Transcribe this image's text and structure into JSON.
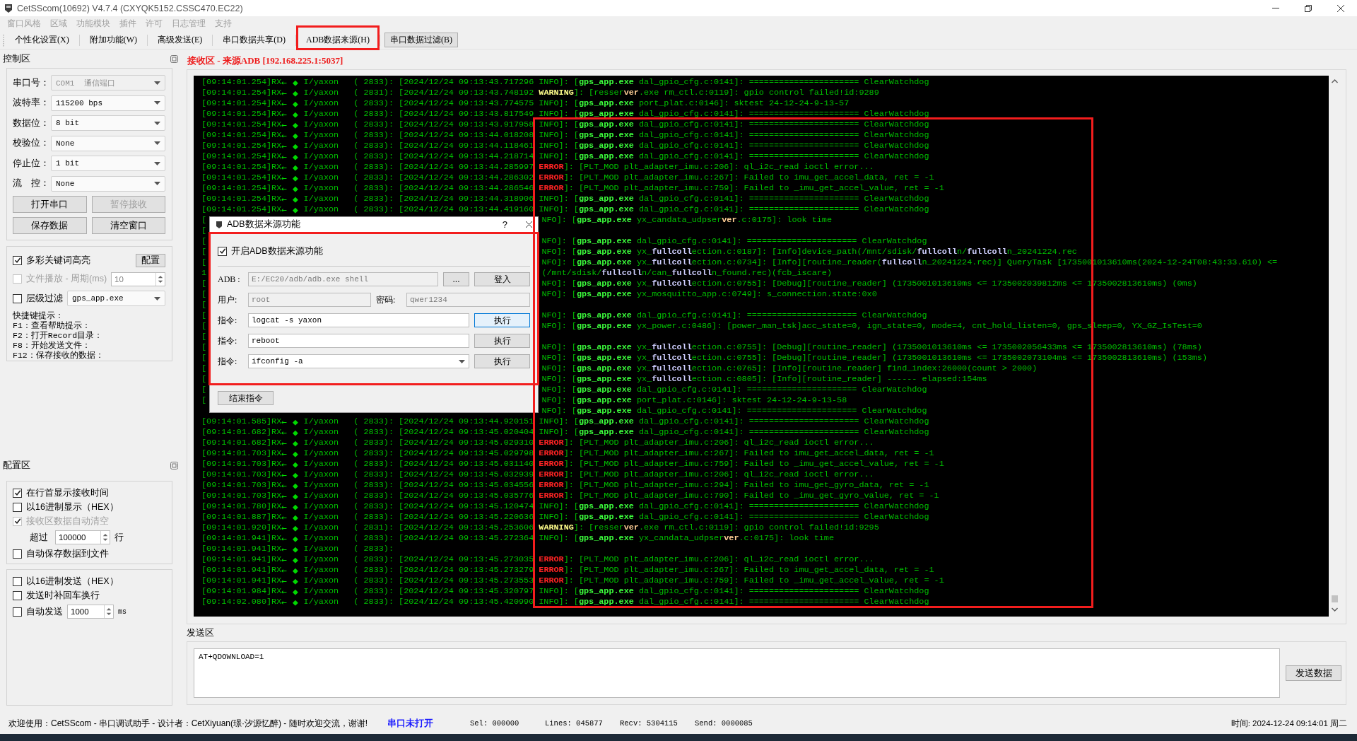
{
  "window": {
    "title": "CetSScom(10692) V4.7.4 (CXYQK5152.CSSC470.EC22)"
  },
  "menu": [
    {
      "label": "窗口风格",
      "disabled": true
    },
    {
      "label": "区域",
      "disabled": true
    },
    {
      "label": "功能模块",
      "disabled": true
    },
    {
      "label": "插件",
      "disabled": true
    },
    {
      "label": "许可",
      "disabled": true
    },
    {
      "label": "日志管理",
      "disabled": true
    },
    {
      "label": "支持",
      "disabled": true
    }
  ],
  "toolbar": [
    {
      "label": "个性化设置(X)",
      "selected": false,
      "annotated": false
    },
    {
      "label": "附加功能(W)",
      "selected": false,
      "annotated": false
    },
    {
      "label": "高级发送(E)",
      "selected": false,
      "annotated": false
    },
    {
      "label": "串口数据共享(D)",
      "selected": false,
      "annotated": false
    },
    {
      "label": "ADB数据来源(H)",
      "selected": false,
      "annotated": true
    },
    {
      "label": "串口数据过滤(B)",
      "selected": true,
      "annotated": false
    }
  ],
  "control_panel": {
    "title": "控制区",
    "port_settings": [
      {
        "label": "串口号：",
        "value": "COM1  通信端口",
        "disabled": true
      },
      {
        "label": "波特率：",
        "value": "115200 bps",
        "disabled": false
      },
      {
        "label": "数据位：",
        "value": "8 bit",
        "disabled": false
      },
      {
        "label": "校验位：",
        "value": "None",
        "disabled": false
      },
      {
        "label": "停止位：",
        "value": "1 bit",
        "disabled": false
      },
      {
        "label": "流　控：",
        "value": "None",
        "disabled": false
      }
    ],
    "buttons": [
      {
        "label": "打开串口",
        "disabled": false
      },
      {
        "label": "暂停接收",
        "disabled": true
      },
      {
        "label": "保存数据",
        "disabled": false
      },
      {
        "label": "清空窗口",
        "disabled": false
      }
    ],
    "options": [
      {
        "kind": "check_button",
        "label": "多彩关键词高亮",
        "checked": true,
        "disabled": false,
        "button": "配置"
      },
      {
        "kind": "check_spin",
        "label": "文件播放 - 周期(ms)",
        "checked": false,
        "disabled": true,
        "value": "10"
      },
      {
        "kind": "check_combo",
        "label": "层级过滤",
        "checked": false,
        "disabled": false,
        "value": "gps_app.exe"
      }
    ],
    "hints": [
      "快捷键提示：",
      "F1：查看帮助提示：",
      "F2：打开Record目录：",
      "F8：开始发送文件：",
      "F12：保存接收的数据："
    ]
  },
  "config_panel": {
    "title": "配置区",
    "receive_options": [
      {
        "kind": "check",
        "label": "在行首显示接收时间",
        "checked": true,
        "disabled": false
      },
      {
        "kind": "check",
        "label": "以16进制显示（HEX）",
        "checked": false,
        "disabled": false
      },
      {
        "kind": "check",
        "label": "接收区数据自动清空",
        "checked": true,
        "disabled": true
      },
      {
        "kind": "spin",
        "label": "超过",
        "value": "100000",
        "unit": "行"
      },
      {
        "kind": "check",
        "label": "自动保存数据到文件",
        "checked": false,
        "disabled": false
      }
    ],
    "send_options": [
      {
        "kind": "check",
        "label": "以16进制发送（HEX）",
        "checked": false,
        "disabled": false
      },
      {
        "kind": "check",
        "label": "发送时补回车换行",
        "checked": false,
        "disabled": false
      },
      {
        "kind": "check_spin",
        "label": "自动发送",
        "checked": false,
        "disabled": false,
        "value": "1000",
        "unit": "ms"
      }
    ]
  },
  "receive": {
    "title": "接收区 - 来源ADB [192.168.225.1:5037]",
    "annotated": true,
    "lines": [
      {
        "kind": "full",
        "segments": [
          {
            "text": "[09:14:01.254]RX"
          },
          {
            "text": "←",
            "kind": "wide"
          },
          {
            "text": "◆",
            "kind": "wide"
          },
          {
            "text": "I/yaxon   ( 2833): [2024/12/24 09:13:43.717296 INFO]: ["
          },
          {
            "text": "gps_app.exe",
            "kind": "app"
          },
          {
            "text": " dal_gpio_cfg.c:0141]: ====================== ClearWatchdog"
          }
        ]
      },
      {
        "kind": "full",
        "segments": [
          {
            "text": "[09:14:01.254]RX"
          },
          {
            "text": "←",
            "kind": "wide"
          },
          {
            "text": "◆",
            "kind": "wide"
          },
          {
            "text": "I/yaxon   ( 2831): [2024/12/24 09:13:43.748192 "
          },
          {
            "text": "WARNING",
            "kind": "warning"
          },
          {
            "text": "]: [resser"
          },
          {
            "text": "ver",
            "kind": "ver"
          },
          {
            "text": ".exe rm_ctl.c:0119]: gpio control failed!id:9289"
          }
        ]
      },
      {
        "kind": "full",
        "segments": [
          {
            "text": "[09:14:01.254]RX"
          },
          {
            "text": "←",
            "kind": "wide"
          },
          {
            "text": "◆",
            "kind": "wide"
          },
          {
            "text": "I/yaxon   ( 2833): [2024/12/24 09:13:43.774575 INFO]: ["
          },
          {
            "text": "gps_app.exe",
            "kind": "app"
          },
          {
            "text": " port_plat.c:0146]: sktest 24-12-24-9-13-57"
          }
        ]
      },
      {
        "kind": "full",
        "segments": [
          {
            "text": "[09:14:01.254]RX"
          },
          {
            "text": "←",
            "kind": "wide"
          },
          {
            "text": "◆",
            "kind": "wide"
          },
          {
            "text": "I/yaxon   ( 2833): [2024/12/24 09:13:43.817549 INFO]: ["
          },
          {
            "text": "gps_app.exe",
            "kind": "app"
          },
          {
            "text": " dal_gpio_cfg.c:0141]: ====================== ClearWatchdog"
          }
        ]
      },
      {
        "kind": "full",
        "segments": [
          {
            "text": "[09:14:01.254]RX"
          },
          {
            "text": "←",
            "kind": "wide"
          },
          {
            "text": "◆",
            "kind": "wide"
          },
          {
            "text": "I/yaxon   ( 2833): [2024/12/24 09:13:43.917958 INFO]: ["
          },
          {
            "text": "gps_app.exe",
            "kind": "app"
          },
          {
            "text": " dal_gpio_cfg.c:0141]: ====================== ClearWatchdog"
          }
        ]
      },
      {
        "kind": "full",
        "segments": [
          {
            "text": "[09:14:01.254]RX"
          },
          {
            "text": "←",
            "kind": "wide"
          },
          {
            "text": "◆",
            "kind": "wide"
          },
          {
            "text": "I/yaxon   ( 2833): [2024/12/24 09:13:44.018208 INFO]: ["
          },
          {
            "text": "gps_app.exe",
            "kind": "app"
          },
          {
            "text": " dal_gpio_cfg.c:0141]: ====================== ClearWatchdog"
          }
        ]
      },
      {
        "kind": "full",
        "segments": [
          {
            "text": "[09:14:01.254]RX"
          },
          {
            "text": "←",
            "kind": "wide"
          },
          {
            "text": "◆",
            "kind": "wide"
          },
          {
            "text": "I/yaxon   ( 2833): [2024/12/24 09:13:44.118461 INFO]: ["
          },
          {
            "text": "gps_app.exe",
            "kind": "app"
          },
          {
            "text": " dal_gpio_cfg.c:0141]: ====================== ClearWatchdog"
          }
        ]
      },
      {
        "kind": "full",
        "segments": [
          {
            "text": "[09:14:01.254]RX"
          },
          {
            "text": "←",
            "kind": "wide"
          },
          {
            "text": "◆",
            "kind": "wide"
          },
          {
            "text": "I/yaxon   ( 2833): [2024/12/24 09:13:44.218714 INFO]: ["
          },
          {
            "text": "gps_app.exe",
            "kind": "app"
          },
          {
            "text": " dal_gpio_cfg.c:0141]: ====================== ClearWatchdog"
          }
        ]
      },
      {
        "kind": "full",
        "segments": [
          {
            "text": "[09:14:01.254]RX"
          },
          {
            "text": "←",
            "kind": "wide"
          },
          {
            "text": "◆",
            "kind": "wide"
          },
          {
            "text": "I/yaxon   ( 2833): [2024/12/24 09:13:44.285997 "
          },
          {
            "text": "ERROR",
            "kind": "error"
          },
          {
            "text": "]: [PLT_MOD plt_adapter_imu.c:206]: ql_i2c_read ioctl error..."
          }
        ]
      },
      {
        "kind": "full",
        "segments": [
          {
            "text": "[09:14:01.254]RX"
          },
          {
            "text": "←",
            "kind": "wide"
          },
          {
            "text": "◆",
            "kind": "wide"
          },
          {
            "text": "I/yaxon   ( 2833): [2024/12/24 09:13:44.286302 "
          },
          {
            "text": "ERROR",
            "kind": "error"
          },
          {
            "text": "]: [PLT_MOD plt_adapter_imu.c:267]: Failed to imu_get_accel_data, ret = -1"
          }
        ]
      },
      {
        "kind": "full",
        "segments": [
          {
            "text": "[09:14:01.254]RX"
          },
          {
            "text": "←",
            "kind": "wide"
          },
          {
            "text": "◆",
            "kind": "wide"
          },
          {
            "text": "I/yaxon   ( 2833): [2024/12/24 09:13:44.286546 "
          },
          {
            "text": "ERROR",
            "kind": "error"
          },
          {
            "text": "]: [PLT_MOD plt_adapter_imu.c:759]: Failed to _imu_get_accel_value, ret = -1"
          }
        ]
      },
      {
        "kind": "full",
        "segments": [
          {
            "text": "[09:14:01.254]RX"
          },
          {
            "text": "←",
            "kind": "wide"
          },
          {
            "text": "◆",
            "kind": "wide"
          },
          {
            "text": "I/yaxon   ( 2833): [2024/12/24 09:13:44.318906 INFO]: ["
          },
          {
            "text": "gps_app.exe",
            "kind": "app"
          },
          {
            "text": " dal_gpio_cfg.c:0141]: ====================== ClearWatchdog"
          }
        ]
      },
      {
        "kind": "full",
        "segments": [
          {
            "text": "[09:14:01.254]RX"
          },
          {
            "text": "←",
            "kind": "wide"
          },
          {
            "text": "◆",
            "kind": "wide"
          },
          {
            "text": "I/yaxon   ( 2833): [2024/12/24 09:13:44.419160 INFO]: ["
          },
          {
            "text": "gps_app.exe",
            "kind": "app"
          },
          {
            "text": " dal_gpio_cfg.c:0141]: ====================== ClearWatchdog"
          }
        ]
      },
      {
        "kind": "covered",
        "lead": "[",
        "segments": [
          {
            "text": "NFO]: ["
          },
          {
            "text": "gps_app.exe",
            "kind": "app"
          },
          {
            "text": " yx_candata_udpser"
          },
          {
            "text": "ver",
            "kind": "ver"
          },
          {
            "text": ".c:0175]: look time"
          }
        ]
      },
      {
        "kind": "covered",
        "lead": "["
      },
      {
        "kind": "covered",
        "lead": "[",
        "segments": [
          {
            "text": "NFO]: ["
          },
          {
            "text": "gps_app.exe",
            "kind": "app"
          },
          {
            "text": " dal_gpio_cfg.c:0141]: ====================== ClearWatchdog"
          }
        ]
      },
      {
        "kind": "covered",
        "lead": "[",
        "segments": [
          {
            "text": "NFO]: ["
          },
          {
            "text": "gps_app.exe",
            "kind": "app"
          },
          {
            "text": " yx_"
          },
          {
            "text": "fullcoll",
            "kind": "key"
          },
          {
            "text": "ection.c:0187]: [Info]device_path(/mnt/sdisk/"
          },
          {
            "text": "fullcoll",
            "kind": "key"
          },
          {
            "text": "n/"
          },
          {
            "text": "fullcoll",
            "kind": "key"
          },
          {
            "text": "n_20241224.rec"
          }
        ]
      },
      {
        "kind": "covered",
        "lead": "[",
        "segments": [
          {
            "text": "NFO]: ["
          },
          {
            "text": "gps_app.exe",
            "kind": "app"
          },
          {
            "text": " yx_"
          },
          {
            "text": "fullcoll",
            "kind": "key"
          },
          {
            "text": "ection.c:0734]: [Info][routine_reader("
          },
          {
            "text": "fullcoll",
            "kind": "key"
          },
          {
            "text": "n_20241224.rec)] QueryTask [1735001013610ms(2024-12-24T08:43:33.610) <="
          }
        ]
      },
      {
        "kind": "covered",
        "lead": "1",
        "segments": [
          {
            "text": "(/mnt/sdisk/"
          },
          {
            "text": "fullcoll",
            "kind": "key"
          },
          {
            "text": "n/can_"
          },
          {
            "text": "fullcoll",
            "kind": "key"
          },
          {
            "text": "n_found.rec)(fcb_iscare)"
          }
        ]
      },
      {
        "kind": "covered",
        "lead": "[",
        "segments": [
          {
            "text": "NFO]: ["
          },
          {
            "text": "gps_app.exe",
            "kind": "app"
          },
          {
            "text": " yx_"
          },
          {
            "text": "fullcoll",
            "kind": "key"
          },
          {
            "text": "ection.c:0755]: [Debug][routine_reader] (1735001013610ms <= 1735002039812ms <= 1735002813610ms) (0ms)"
          }
        ]
      },
      {
        "kind": "covered",
        "lead": "[",
        "segments": [
          {
            "text": "NFO]: ["
          },
          {
            "text": "gps_app.exe",
            "kind": "app"
          },
          {
            "text": " yx_mosquitto_app.c:0749]: s_connection.state:0x0"
          }
        ]
      },
      {
        "kind": "covered",
        "lead": "["
      },
      {
        "kind": "covered",
        "lead": "[",
        "segments": [
          {
            "text": "NFO]: ["
          },
          {
            "text": "gps_app.exe",
            "kind": "app"
          },
          {
            "text": " dal_gpio_cfg.c:0141]: ====================== ClearWatchdog"
          }
        ]
      },
      {
        "kind": "covered",
        "lead": "[",
        "segments": [
          {
            "text": "NFO]: ["
          },
          {
            "text": "gps_app.exe",
            "kind": "app"
          },
          {
            "text": " yx_power.c:0486]: [power_man_tsk]acc_state=0, ign_state=0, mode=4, cnt_hold_listen=0, gps_sleep=0, YX_GZ_IsTest=0"
          }
        ]
      },
      {
        "kind": "covered",
        "lead": "["
      },
      {
        "kind": "covered",
        "lead": "[",
        "segments": [
          {
            "text": "NFO]: ["
          },
          {
            "text": "gps_app.exe",
            "kind": "app"
          },
          {
            "text": " yx_"
          },
          {
            "text": "fullcoll",
            "kind": "key"
          },
          {
            "text": "ection.c:0755]: [Debug][routine_reader] (1735001013610ms <= 1735002056433ms <= 1735002813610ms) (78ms)"
          }
        ]
      },
      {
        "kind": "covered",
        "lead": "[",
        "segments": [
          {
            "text": "NFO]: ["
          },
          {
            "text": "gps_app.exe",
            "kind": "app"
          },
          {
            "text": " yx_"
          },
          {
            "text": "fullcoll",
            "kind": "key"
          },
          {
            "text": "ection.c:0755]: [Debug][routine_reader] (1735001013610ms <= 1735002073104ms <= 1735002813610ms) (153ms)"
          }
        ]
      },
      {
        "kind": "covered",
        "lead": "[",
        "segments": [
          {
            "text": "NFO]: ["
          },
          {
            "text": "gps_app.exe",
            "kind": "app"
          },
          {
            "text": " yx_"
          },
          {
            "text": "fullcoll",
            "kind": "key"
          },
          {
            "text": "ection.c:0765]: [Info][routine_reader] find_index:26000(count > 2000)"
          }
        ]
      },
      {
        "kind": "covered",
        "lead": "[",
        "segments": [
          {
            "text": "NFO]: ["
          },
          {
            "text": "gps_app.exe",
            "kind": "app"
          },
          {
            "text": " yx_"
          },
          {
            "text": "fullcoll",
            "kind": "key"
          },
          {
            "text": "ection.c:0805]: [Info][routine_reader] ------ elapsed:154ms"
          }
        ]
      },
      {
        "kind": "covered",
        "lead": "[",
        "segments": [
          {
            "text": "NFO]: ["
          },
          {
            "text": "gps_app.exe",
            "kind": "app"
          },
          {
            "text": " dal_gpio_cfg.c:0141]: ====================== ClearWatchdog"
          }
        ]
      },
      {
        "kind": "covered",
        "lead": "[",
        "segments": [
          {
            "text": "NFO]: ["
          },
          {
            "text": "gps_app.exe",
            "kind": "app"
          },
          {
            "text": " port_plat.c:0146]: sktest 24-12-24-9-13-58"
          }
        ]
      },
      {
        "kind": "covered",
        "segments": [
          {
            "text": "NFO]: ["
          },
          {
            "text": "gps_app.exe",
            "kind": "app"
          },
          {
            "text": " dal_gpio_cfg.c:0141]: ====================== ClearWatchdog"
          }
        ]
      },
      {
        "kind": "full",
        "segments": [
          {
            "text": "[09:14:01.585]RX"
          },
          {
            "text": "←",
            "kind": "wide"
          },
          {
            "text": "◆",
            "kind": "wide"
          },
          {
            "text": "I/yaxon   ( 2833): [2024/12/24 09:13:44.920151 INFO]: ["
          },
          {
            "text": "gps_app.exe",
            "kind": "app"
          },
          {
            "text": " dal_gpio_cfg.c:0141]: ====================== ClearWatchdog"
          }
        ]
      },
      {
        "kind": "full",
        "segments": [
          {
            "text": "[09:14:01.682]RX"
          },
          {
            "text": "←",
            "kind": "wide"
          },
          {
            "text": "◆",
            "kind": "wide"
          },
          {
            "text": "I/yaxon   ( 2833): [2024/12/24 09:13:45.020404 INFO]: ["
          },
          {
            "text": "gps_app.exe",
            "kind": "app"
          },
          {
            "text": " dal_gpio_cfg.c:0141]: ====================== ClearWatchdog"
          }
        ]
      },
      {
        "kind": "full",
        "segments": [
          {
            "text": "[09:14:01.682]RX"
          },
          {
            "text": "←",
            "kind": "wide"
          },
          {
            "text": "◆",
            "kind": "wide"
          },
          {
            "text": "I/yaxon   ( 2833): [2024/12/24 09:13:45.029310 "
          },
          {
            "text": "ERROR",
            "kind": "error"
          },
          {
            "text": "]: [PLT_MOD plt_adapter_imu.c:206]: ql_i2c_read ioctl error..."
          }
        ]
      },
      {
        "kind": "full",
        "segments": [
          {
            "text": "[09:14:01.703]RX"
          },
          {
            "text": "←",
            "kind": "wide"
          },
          {
            "text": "◆",
            "kind": "wide"
          },
          {
            "text": "I/yaxon   ( 2833): [2024/12/24 09:13:45.029798 "
          },
          {
            "text": "ERROR",
            "kind": "error"
          },
          {
            "text": "]: [PLT_MOD plt_adapter_imu.c:267]: Failed to imu_get_accel_data, ret = -1"
          }
        ]
      },
      {
        "kind": "full",
        "segments": [
          {
            "text": "[09:14:01.703]RX"
          },
          {
            "text": "←",
            "kind": "wide"
          },
          {
            "text": "◆",
            "kind": "wide"
          },
          {
            "text": "I/yaxon   ( 2833): [2024/12/24 09:13:45.031140 "
          },
          {
            "text": "ERROR",
            "kind": "error"
          },
          {
            "text": "]: [PLT_MOD plt_adapter_imu.c:759]: Failed to _imu_get_accel_value, ret = -1"
          }
        ]
      },
      {
        "kind": "full",
        "segments": [
          {
            "text": "[09:14:01.703]RX"
          },
          {
            "text": "←",
            "kind": "wide"
          },
          {
            "text": "◆",
            "kind": "wide"
          },
          {
            "text": "I/yaxon   ( 2833): [2024/12/24 09:13:45.032939 "
          },
          {
            "text": "ERROR",
            "kind": "error"
          },
          {
            "text": "]: [PLT_MOD plt_adapter_imu.c:206]: ql_i2c_read ioctl error..."
          }
        ]
      },
      {
        "kind": "full",
        "segments": [
          {
            "text": "[09:14:01.703]RX"
          },
          {
            "text": "←",
            "kind": "wide"
          },
          {
            "text": "◆",
            "kind": "wide"
          },
          {
            "text": "I/yaxon   ( 2833): [2024/12/24 09:13:45.034556 "
          },
          {
            "text": "ERROR",
            "kind": "error"
          },
          {
            "text": "]: [PLT_MOD plt_adapter_imu.c:294]: Failed to imu_get_gyro_data, ret = -1"
          }
        ]
      },
      {
        "kind": "full",
        "segments": [
          {
            "text": "[09:14:01.703]RX"
          },
          {
            "text": "←",
            "kind": "wide"
          },
          {
            "text": "◆",
            "kind": "wide"
          },
          {
            "text": "I/yaxon   ( 2833): [2024/12/24 09:13:45.035776 "
          },
          {
            "text": "ERROR",
            "kind": "error"
          },
          {
            "text": "]: [PLT_MOD plt_adapter_imu.c:790]: Failed to _imu_get_gyro_value, ret = -1"
          }
        ]
      },
      {
        "kind": "full",
        "segments": [
          {
            "text": "[09:14:01.780]RX"
          },
          {
            "text": "←",
            "kind": "wide"
          },
          {
            "text": "◆",
            "kind": "wide"
          },
          {
            "text": "I/yaxon   ( 2833): [2024/12/24 09:13:45.120474 INFO]: ["
          },
          {
            "text": "gps_app.exe",
            "kind": "app"
          },
          {
            "text": " dal_gpio_cfg.c:0141]: ====================== ClearWatchdog"
          }
        ]
      },
      {
        "kind": "full",
        "segments": [
          {
            "text": "[09:14:01.887]RX"
          },
          {
            "text": "←",
            "kind": "wide"
          },
          {
            "text": "◆",
            "kind": "wide"
          },
          {
            "text": "I/yaxon   ( 2833): [2024/12/24 09:13:45.220636 INFO]: ["
          },
          {
            "text": "gps_app.exe",
            "kind": "app"
          },
          {
            "text": " dal_gpio_cfg.c:0141]: ====================== ClearWatchdog"
          }
        ]
      },
      {
        "kind": "full",
        "segments": [
          {
            "text": "[09:14:01.920]RX"
          },
          {
            "text": "←",
            "kind": "wide"
          },
          {
            "text": "◆",
            "kind": "wide"
          },
          {
            "text": "I/yaxon   ( 2831): [2024/12/24 09:13:45.253606 "
          },
          {
            "text": "WARNING",
            "kind": "warning"
          },
          {
            "text": "]: [resser"
          },
          {
            "text": "ver",
            "kind": "ver"
          },
          {
            "text": ".exe rm_ctl.c:0119]: gpio control failed!id:9295"
          }
        ]
      },
      {
        "kind": "full",
        "segments": [
          {
            "text": "[09:14:01.941]RX"
          },
          {
            "text": "←",
            "kind": "wide"
          },
          {
            "text": "◆",
            "kind": "wide"
          },
          {
            "text": "I/yaxon   ( 2833): [2024/12/24 09:13:45.272364 INFO]: ["
          },
          {
            "text": "gps_app.exe",
            "kind": "app"
          },
          {
            "text": " yx_candata_udpser"
          },
          {
            "text": "ver",
            "kind": "ver"
          },
          {
            "text": ".c:0175]: look time"
          }
        ]
      },
      {
        "kind": "full",
        "segments": [
          {
            "text": "[09:14:01.941]RX"
          },
          {
            "text": "←",
            "kind": "wide"
          },
          {
            "text": "◆",
            "kind": "wide"
          },
          {
            "text": "I/yaxon   ( 2833):"
          }
        ]
      },
      {
        "kind": "full",
        "segments": [
          {
            "text": "[09:14:01.941]RX"
          },
          {
            "text": "←",
            "kind": "wide"
          },
          {
            "text": "◆",
            "kind": "wide"
          },
          {
            "text": "I/yaxon   ( 2833): [2024/12/24 09:13:45.273035 "
          },
          {
            "text": "ERROR",
            "kind": "error"
          },
          {
            "text": "]: [PLT_MOD plt_adapter_imu.c:206]: ql_i2c_read ioctl error..."
          }
        ]
      },
      {
        "kind": "full",
        "segments": [
          {
            "text": "[09:14:01.941]RX"
          },
          {
            "text": "←",
            "kind": "wide"
          },
          {
            "text": "◆",
            "kind": "wide"
          },
          {
            "text": "I/yaxon   ( 2833): [2024/12/24 09:13:45.273279 "
          },
          {
            "text": "ERROR",
            "kind": "error"
          },
          {
            "text": "]: [PLT_MOD plt_adapter_imu.c:267]: Failed to imu_get_accel_data, ret = -1"
          }
        ]
      },
      {
        "kind": "full",
        "segments": [
          {
            "text": "[09:14:01.941]RX"
          },
          {
            "text": "←",
            "kind": "wide"
          },
          {
            "text": "◆",
            "kind": "wide"
          },
          {
            "text": "I/yaxon   ( 2833): [2024/12/24 09:13:45.273553 "
          },
          {
            "text": "ERROR",
            "kind": "error"
          },
          {
            "text": "]: [PLT_MOD plt_adapter_imu.c:759]: Failed to _imu_get_accel_value, ret = -1"
          }
        ]
      },
      {
        "kind": "full",
        "segments": [
          {
            "text": "[09:14:01.984]RX"
          },
          {
            "text": "←",
            "kind": "wide"
          },
          {
            "text": "◆",
            "kind": "wide"
          },
          {
            "text": "I/yaxon   ( 2833): [2024/12/24 09:13:45.320797 INFO]: ["
          },
          {
            "text": "gps_app.exe",
            "kind": "app"
          },
          {
            "text": " dal_gpio_cfg.c:0141]: ====================== ClearWatchdog"
          }
        ]
      },
      {
        "kind": "full",
        "segments": [
          {
            "text": "[09:14:02.080]RX"
          },
          {
            "text": "←",
            "kind": "wide"
          },
          {
            "text": "◆",
            "kind": "wide"
          },
          {
            "text": "I/yaxon   ( 2833): [2024/12/24 09:13:45.420990 INFO]: ["
          },
          {
            "text": "gps_app.exe",
            "kind": "app"
          },
          {
            "text": " dal_gpio_cfg.c:0141]: ====================== ClearWatchdog"
          }
        ]
      }
    ]
  },
  "send": {
    "title": "发送区",
    "text": "AT+QDOWNLOAD=1",
    "button": "发送数据"
  },
  "status_bar": {
    "welcome": "欢迎使用：CetSScom - 串口调试助手 - 设计者：CetXiyuan(璟·汐源忆醉) - 随时欢迎交流，谢谢!",
    "port_state": "串口未打开",
    "counters": [
      "Sel: 000000",
      "Lines: 045877",
      "Recv: 5304115",
      "Send: 0000085"
    ],
    "time": "时间: 2024-12-24 09:14:01 周二"
  },
  "dialog": {
    "title": "ADB数据来源功能",
    "help": "?",
    "annotated": true,
    "enable": {
      "label": "开启ADB数据来源功能",
      "checked": true
    },
    "adb": {
      "label": "ADB :",
      "value": "E:/EC20/adb/adb.exe shell",
      "disabled": true,
      "browse": "...",
      "login": "登入"
    },
    "user": {
      "label": "用户:",
      "value": "root",
      "disabled": true
    },
    "password": {
      "label": "密码:",
      "value": "qwer1234",
      "disabled": true
    },
    "commands": [
      {
        "kind": "text",
        "label": "指令:",
        "value": "logcat -s yaxon",
        "button": "执行",
        "focused": true
      },
      {
        "kind": "text",
        "label": "指令:",
        "value": "reboot",
        "button": "执行",
        "focused": false
      },
      {
        "kind": "combo",
        "label": "指令:",
        "value": "ifconfig -a",
        "button": "执行",
        "focused": false
      }
    ],
    "stop": "结束指令"
  }
}
